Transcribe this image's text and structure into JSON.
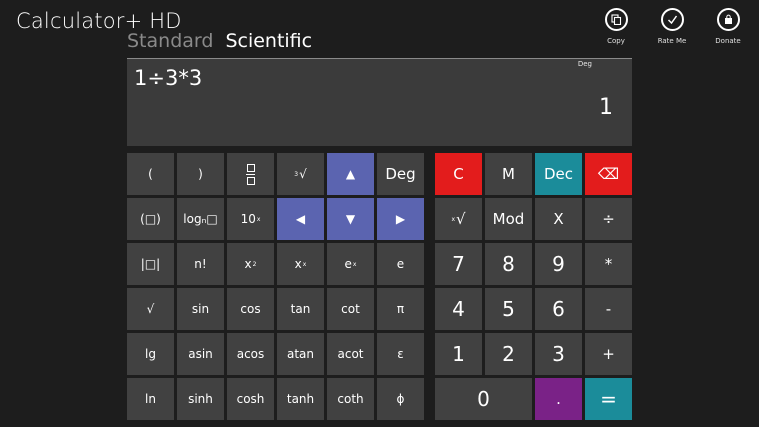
{
  "app": {
    "title": "Calculator+ HD"
  },
  "modes": [
    {
      "label": "Standard"
    },
    {
      "label": "Scientific"
    }
  ],
  "appbar": {
    "copy": "Copy",
    "rate": "Rate Me",
    "donate": "Donate"
  },
  "display": {
    "angle_mode": "Deg",
    "expression": "1÷3*3",
    "result": "1"
  },
  "keys": {
    "lparen": "(",
    "rparen": ")",
    "root_base": "3",
    "root_sym": "√",
    "up": "▲",
    "deg": "Deg",
    "abs_paren": "(□)",
    "log_base": "logₙ□",
    "ten_base": "10",
    "exp_x": "x",
    "left": "◀",
    "down": "▼",
    "right": "▶",
    "abs": "|□|",
    "fact": "n!",
    "square_base": "x",
    "square_exp": "2",
    "power_base": "x",
    "e_base": "e",
    "e_const": "e",
    "sqrt": "√",
    "sin": "sin",
    "cos": "cos",
    "tan": "tan",
    "cot": "cot",
    "pi": "π",
    "lg": "lg",
    "asin": "asin",
    "acos": "acos",
    "atan": "atan",
    "acot": "acot",
    "epsilon": "ε",
    "ln": "ln",
    "sinh": "sinh",
    "cosh": "cosh",
    "tanh": "tanh",
    "coth": "coth",
    "phi": "ϕ",
    "clear": "C",
    "memory": "M",
    "dec": "Dec",
    "backspace": "⌫",
    "nroot_sym": "√",
    "mod": "Mod",
    "x": "X",
    "divide": "÷",
    "seven": "7",
    "eight": "8",
    "nine": "9",
    "multiply": "*",
    "four": "4",
    "five": "5",
    "six": "6",
    "minus": "-",
    "one": "1",
    "two": "2",
    "three": "3",
    "plus": "+",
    "zero": "0",
    "dot": ".",
    "equals": "="
  }
}
